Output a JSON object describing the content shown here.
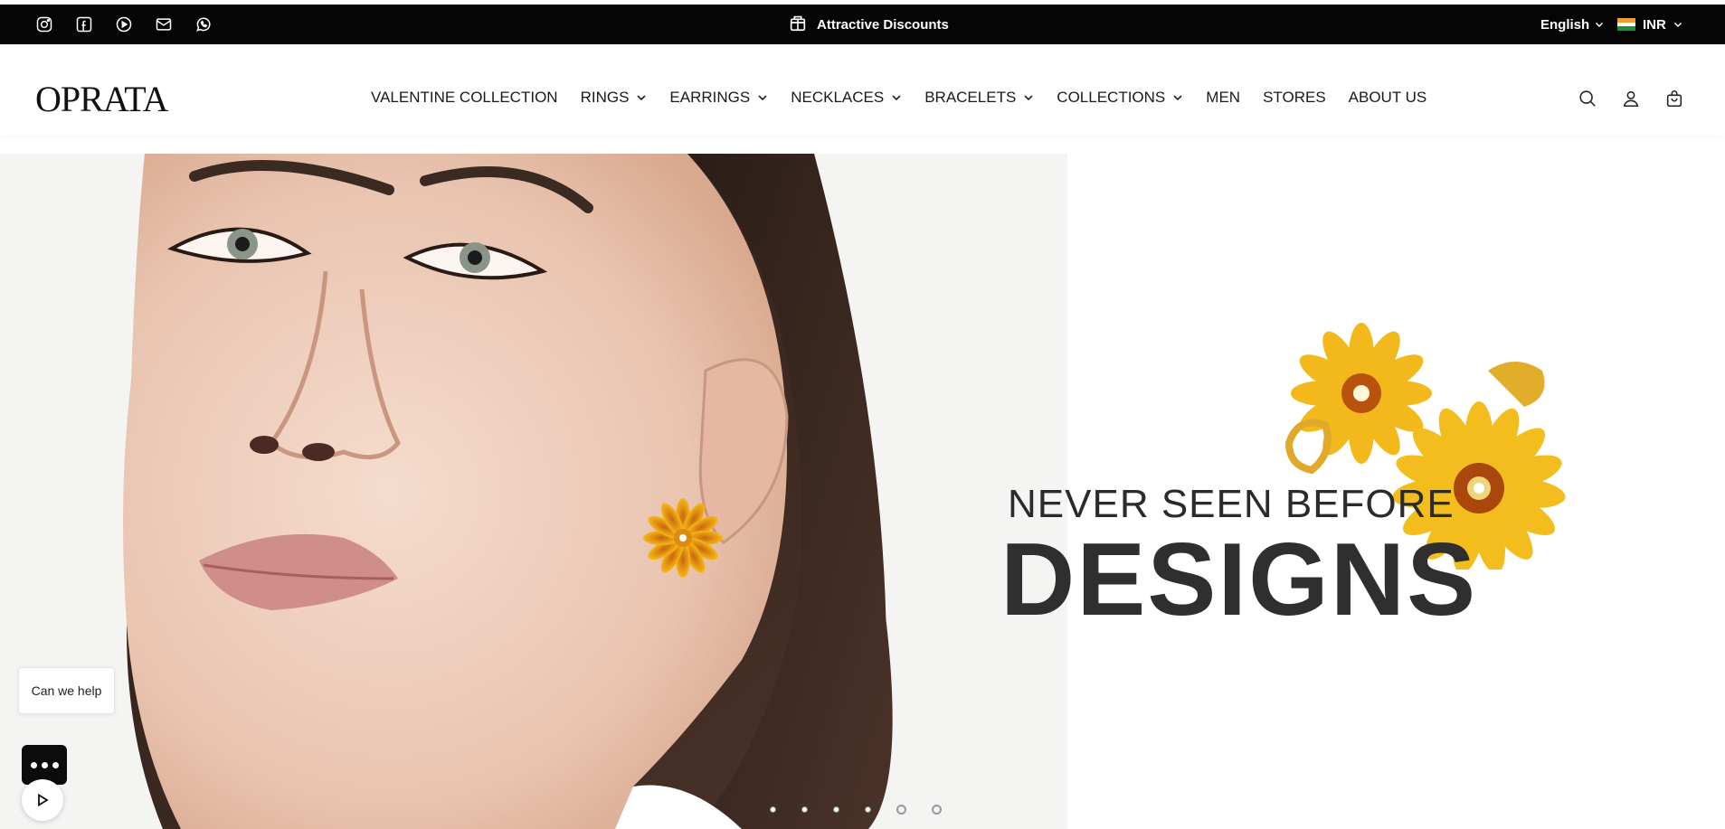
{
  "topbar": {
    "socials": [
      {
        "icon": "instagram-icon"
      },
      {
        "icon": "facebook-icon"
      },
      {
        "icon": "youtube-icon"
      },
      {
        "icon": "mail-icon"
      },
      {
        "icon": "whatsapp-icon"
      }
    ],
    "announcement": "Attractive Discounts",
    "language": "English",
    "currency": "INR"
  },
  "header": {
    "logo": "OPRATA",
    "nav": [
      {
        "label": "VALENTINE COLLECTION",
        "dropdown": false
      },
      {
        "label": "RINGS",
        "dropdown": true
      },
      {
        "label": "EARRINGS",
        "dropdown": true
      },
      {
        "label": "NECKLACES",
        "dropdown": true
      },
      {
        "label": "BRACELETS",
        "dropdown": true
      },
      {
        "label": "COLLECTIONS",
        "dropdown": true
      },
      {
        "label": "MEN",
        "dropdown": false
      },
      {
        "label": "STORES",
        "dropdown": false
      },
      {
        "label": "ABOUT US",
        "dropdown": false
      }
    ]
  },
  "hero": {
    "line1": "NEVER SEEN BEFORE",
    "line2": "DESIGNS",
    "slide_count": 6
  },
  "chat": {
    "prompt": "Can we help"
  },
  "colors": {
    "topbar_bg": "#050505",
    "text_dark": "#2f2f2f",
    "flower_yellow": "#f2b81c"
  }
}
